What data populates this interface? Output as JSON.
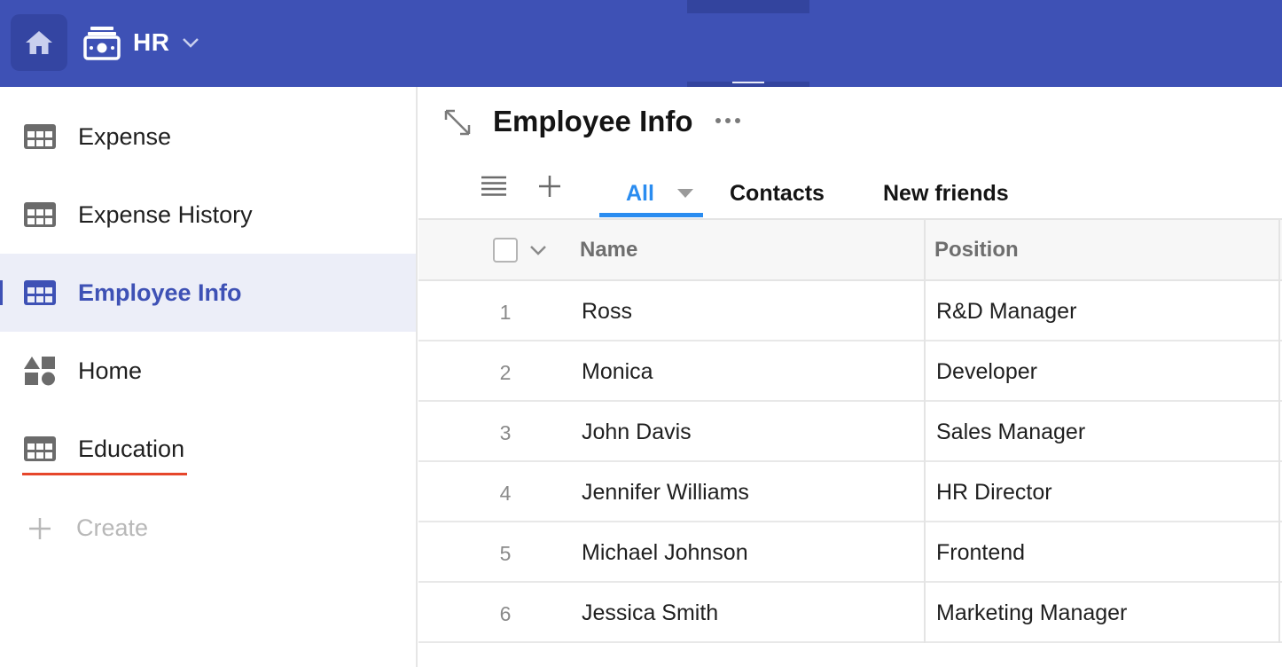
{
  "topbar": {
    "app_name": "HR",
    "icons": {
      "home": "home-icon",
      "app": "money-icon",
      "chevron": "chevron-down-icon"
    },
    "color": "#3e51b5"
  },
  "sidebar": {
    "items": [
      {
        "label": "Expense",
        "icon": "table-icon",
        "active": false
      },
      {
        "label": "Expense History",
        "icon": "table-icon",
        "active": false
      },
      {
        "label": "Employee Info",
        "icon": "table-icon",
        "active": true
      },
      {
        "label": "Home",
        "icon": "shapes-icon",
        "active": false
      },
      {
        "label": "Education",
        "icon": "table-icon",
        "active": false
      }
    ],
    "create_label": "Create",
    "active_color": "#3e51b5",
    "highlight_color": "#e6462b"
  },
  "main": {
    "title": "Employee Info",
    "views": {
      "tabs": [
        {
          "label": "All",
          "active": true
        },
        {
          "label": "Contacts",
          "active": false
        },
        {
          "label": "New friends",
          "active": false
        }
      ],
      "active_color": "#2a8cf0"
    },
    "table": {
      "columns": [
        "Name",
        "Position"
      ],
      "rows": [
        {
          "index": "1",
          "name": "Ross",
          "position": "R&D Manager"
        },
        {
          "index": "2",
          "name": "Monica",
          "position": "Developer"
        },
        {
          "index": "3",
          "name": "John Davis",
          "position": "Sales Manager"
        },
        {
          "index": "4",
          "name": "Jennifer Williams",
          "position": "HR Director"
        },
        {
          "index": "5",
          "name": "Michael Johnson",
          "position": "Frontend"
        },
        {
          "index": "6",
          "name": "Jessica Smith",
          "position": "Marketing Manager"
        }
      ]
    }
  }
}
